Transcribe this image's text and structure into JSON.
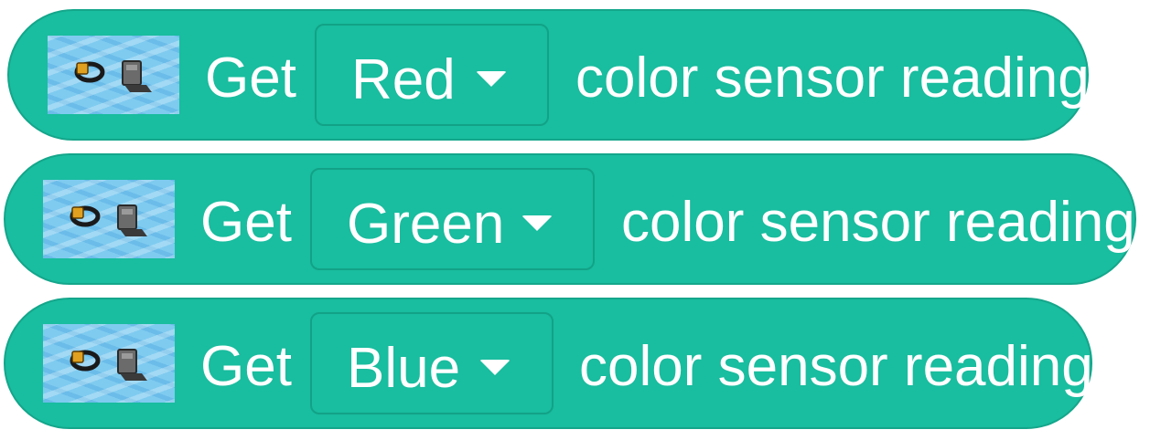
{
  "blocks": [
    {
      "prefix": "Get",
      "selected": "Red",
      "suffix": "color sensor reading"
    },
    {
      "prefix": "Get",
      "selected": "Green",
      "suffix": "color sensor reading"
    },
    {
      "prefix": "Get",
      "selected": "Blue",
      "suffix": "color sensor reading"
    }
  ],
  "icon": "color-sensor-icon",
  "colors": {
    "block_fill": "#19bd9f",
    "block_border": "#14a68b",
    "text": "#ffffff",
    "icon_background": "#7fcbf0"
  }
}
